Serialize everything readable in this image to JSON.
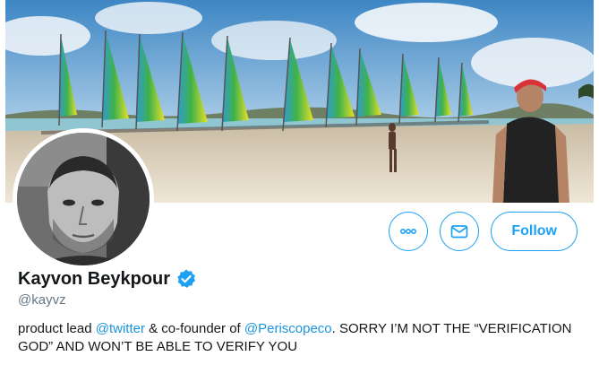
{
  "profile": {
    "display_name": "Kayvon Beykpour",
    "handle": "@kayvz",
    "bio": {
      "part1": "product lead ",
      "mention1": "@twitter",
      "part2": " & co-founder of ",
      "mention2": "@Periscopeco",
      "part3": ". SORRY I’M NOT THE “VERIFICATION GOD” AND WON’T BE ABLE TO VERIFY YOU"
    }
  },
  "actions": {
    "more_icon": "more-dots-icon",
    "message_icon": "envelope-icon",
    "follow_label": "Follow"
  },
  "colors": {
    "accent": "#1da1f2",
    "verified": "#1da1f2",
    "link": "#1b95e0"
  }
}
